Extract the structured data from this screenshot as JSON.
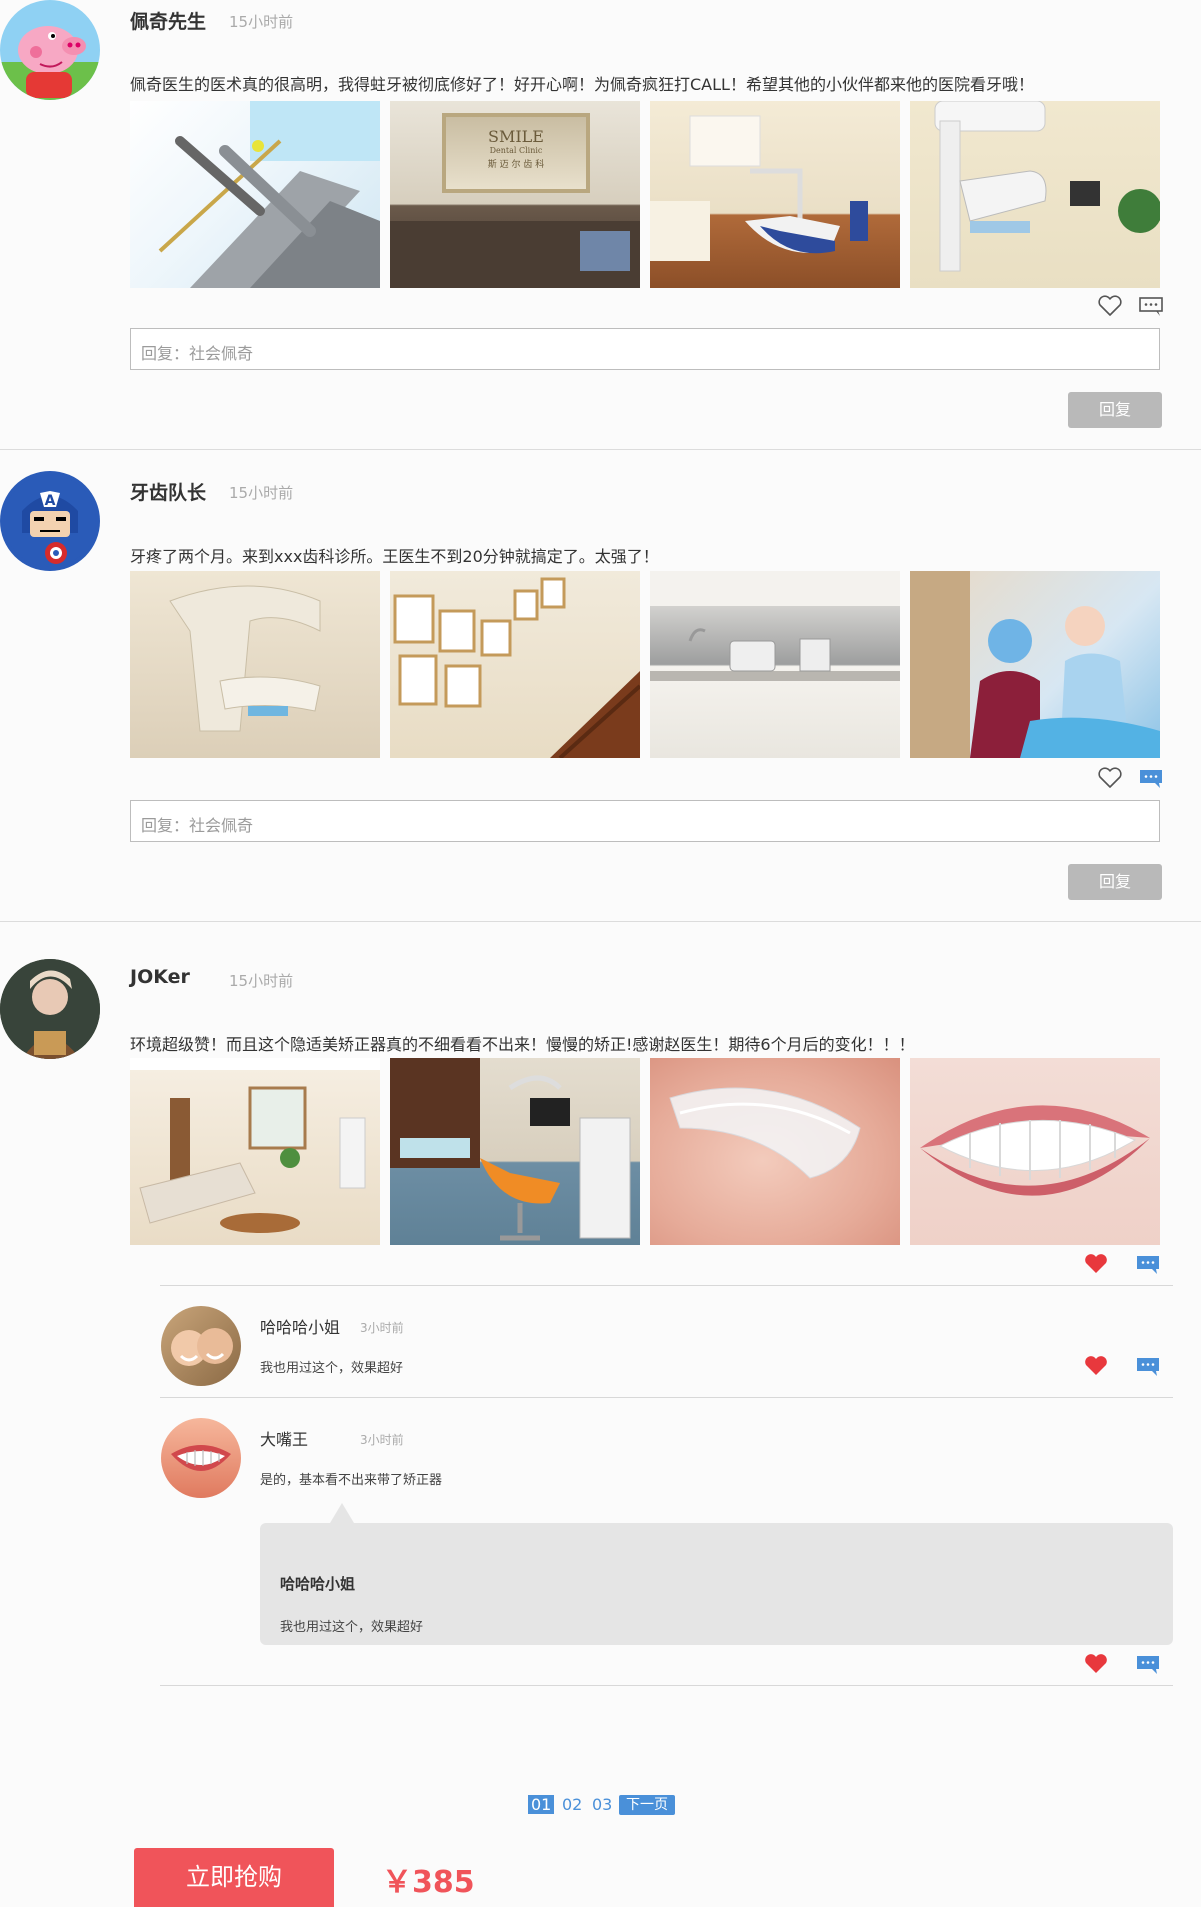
{
  "posts": [
    {
      "name": "佩奇先生",
      "time": "15小时前",
      "content": "佩奇医生的医术真的很高明，我得蛀牙被彻底修好了！好开心啊！为佩奇疯狂打CALL！希望其他的小伙伴都来他的医院看牙哦！",
      "photo_names": [
        "dental-drill-photo",
        "smile-clinic-sign-photo",
        "treatment-room-photo",
        "xray-machine-photo"
      ],
      "photo_sign": {
        "line1": "SMILE",
        "line2": "Dental Clinic",
        "line3": "斯 迈 尔 齿 科"
      },
      "liked": false,
      "reply_placeholder": "回复：社会佩奇",
      "reply_button": "回复"
    },
    {
      "name": "牙齿队长",
      "time": "15小时前",
      "content": "牙疼了两个月。来到xxx齿科诊所。王医生不到20分钟就搞定了。太强了！",
      "photo_names": [
        "panoramic-xray-photo",
        "photo-wall-staircase-photo",
        "sterilization-room-photo",
        "dentists-treating-patient-photo"
      ],
      "liked": false,
      "reply_placeholder": "回复：社会佩奇",
      "reply_button": "回复"
    },
    {
      "name": "JOKer",
      "time": "15小时前",
      "content": "环境超级赞！而且这个隐适美矫正器真的不细看看不出来！慢慢的矫正!感谢赵医生！期待6个月后的变化！！！",
      "photo_names": [
        "waiting-lounge-photo",
        "dental-chair-room-photo",
        "clear-aligner-photo",
        "white-teeth-smile-photo"
      ],
      "liked": true
    }
  ],
  "comments": [
    {
      "name": "哈哈哈小姐",
      "time": "3小时前",
      "text": "我也用过这个，效果超好",
      "liked": true
    },
    {
      "name": "大嘴王",
      "time": "3小时前",
      "text": "是的，基本看不出来带了矫正器",
      "liked": true,
      "quote": {
        "name": "哈哈哈小姐",
        "text": "我也用过这个，效果超好"
      }
    }
  ],
  "pagination": {
    "pages": [
      "01",
      "02",
      "03"
    ],
    "next": "下一页",
    "current": "01"
  },
  "purchase": {
    "buy_label": "立即抢购",
    "price": "￥385"
  },
  "colors": {
    "accent_red": "#f0545a",
    "accent_blue": "#4a90d9",
    "heart_red": "#e8383d"
  },
  "icons": {
    "like": "heart-icon",
    "comment": "comment-icon"
  }
}
